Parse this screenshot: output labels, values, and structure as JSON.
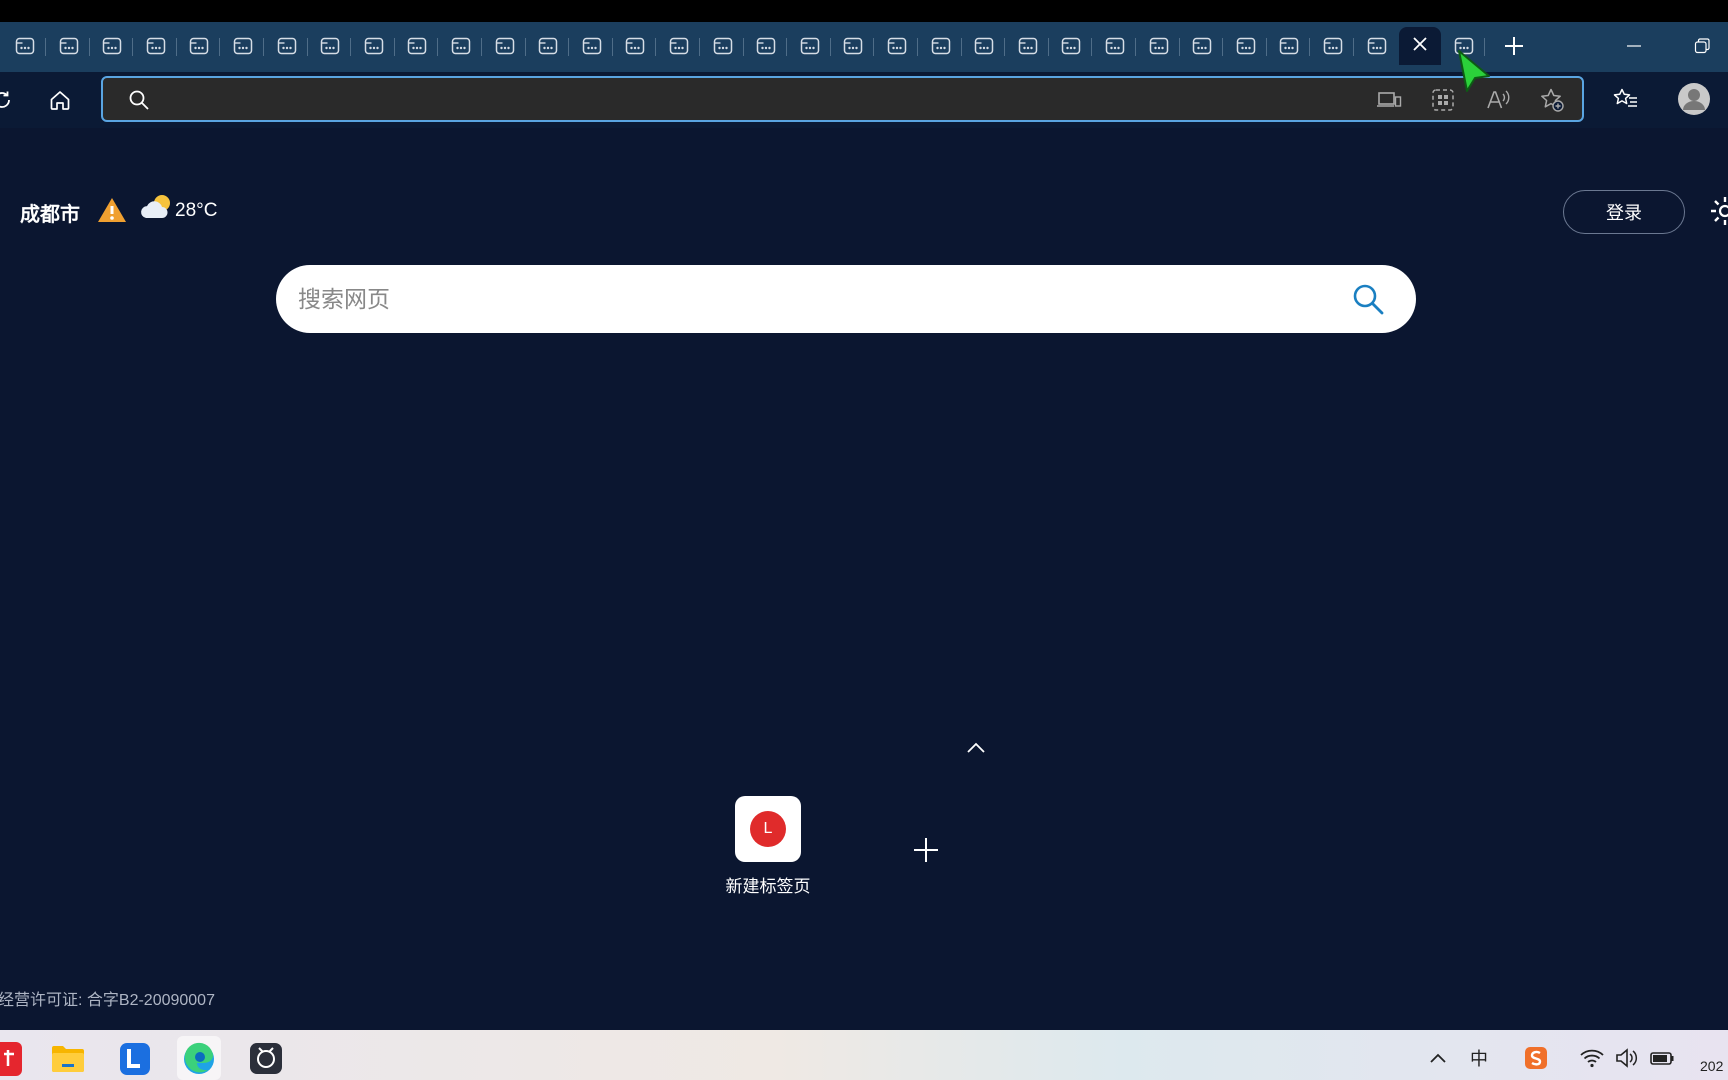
{
  "browser": {
    "tab_count": 34,
    "active_tab_index": 32,
    "new_tab_symbol": "+",
    "window": {
      "minimize": "–",
      "restore": "❐"
    },
    "address_bar": {
      "value": "",
      "placeholder": ""
    }
  },
  "weather": {
    "city": "成都市",
    "temperature": "28°C"
  },
  "header": {
    "login_label": "登录"
  },
  "search": {
    "placeholder": "搜索网页"
  },
  "quick_links": [
    {
      "letter": "L",
      "label": "新建标签页",
      "color": "#e02b2b"
    }
  ],
  "footer": {
    "license": "经营许可证: 合字B2-20090007"
  },
  "taskbar": {
    "tray": {
      "ime": "中",
      "clock": "202"
    }
  },
  "colors": {
    "tabstrip": "#1b3e5e",
    "page_bg": "#0b1630",
    "address_border": "#5aa5e2",
    "search_icon": "#1a7fc1"
  }
}
